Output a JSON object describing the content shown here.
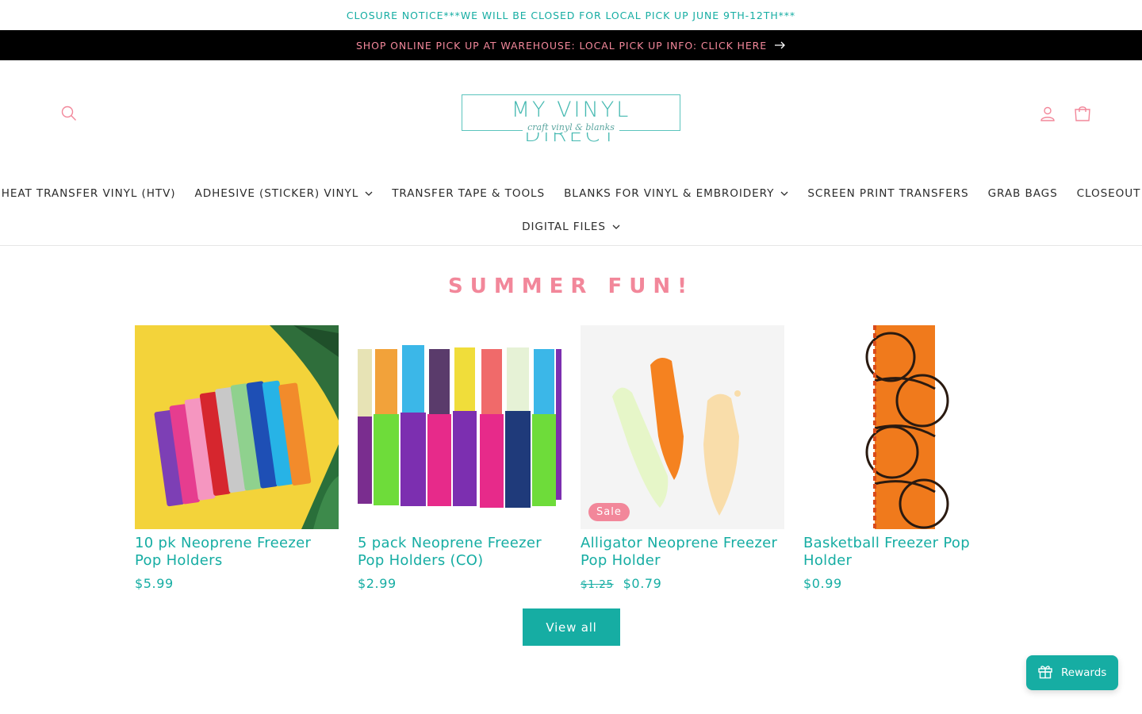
{
  "notice": {
    "text": "CLOSURE NOTICE***WE WILL BE CLOSED FOR LOCAL PICK UP JUNE 9TH-12TH***"
  },
  "announcement": {
    "text": "SHOP ONLINE PICK UP AT WAREHOUSE: LOCAL PICK UP INFO: CLICK HERE",
    "icon": "arrow-right-icon"
  },
  "header": {
    "logo_text": "MY VINYL DIRECT",
    "logo_tagline": "craft vinyl & blanks",
    "icons": [
      "search-icon",
      "account-icon",
      "cart-icon"
    ]
  },
  "nav": {
    "row1": [
      {
        "label": "HEAT TRANSFER VINYL (HTV)",
        "dropdown": false
      },
      {
        "label": "ADHESIVE (STICKER) VINYL",
        "dropdown": true
      },
      {
        "label": "TRANSFER TAPE & TOOLS",
        "dropdown": false
      },
      {
        "label": "BLANKS FOR VINYL & EMBROIDERY",
        "dropdown": true
      },
      {
        "label": "SCREEN PRINT TRANSFERS",
        "dropdown": false
      },
      {
        "label": "GRAB BAGS",
        "dropdown": false
      },
      {
        "label": "CLOSEOUT",
        "dropdown": false
      }
    ],
    "row2": [
      {
        "label": "DIGITAL FILES",
        "dropdown": true
      }
    ]
  },
  "collection": {
    "title": "SUMMER FUN!",
    "products": [
      {
        "title": "10 pk Neoprene Freezer Pop Holders",
        "price": "$5.99",
        "compare_price": "",
        "badge": ""
      },
      {
        "title": "5 pack Neoprene Freezer Pop Holders (CO)",
        "price": "$2.99",
        "compare_price": "",
        "badge": ""
      },
      {
        "title": "Alligator Neoprene Freezer Pop Holder",
        "price": "$0.79",
        "compare_price": "$1.25",
        "badge": "Sale"
      },
      {
        "title": "Basketball Freezer Pop Holder",
        "price": "$0.99",
        "compare_price": "",
        "badge": ""
      }
    ],
    "view_all_label": "View all"
  },
  "rewards": {
    "label": "Rewards",
    "icon": "gift-icon"
  },
  "colors": {
    "teal": "#16ada3",
    "pink": "#f2879a",
    "black": "#000000"
  }
}
